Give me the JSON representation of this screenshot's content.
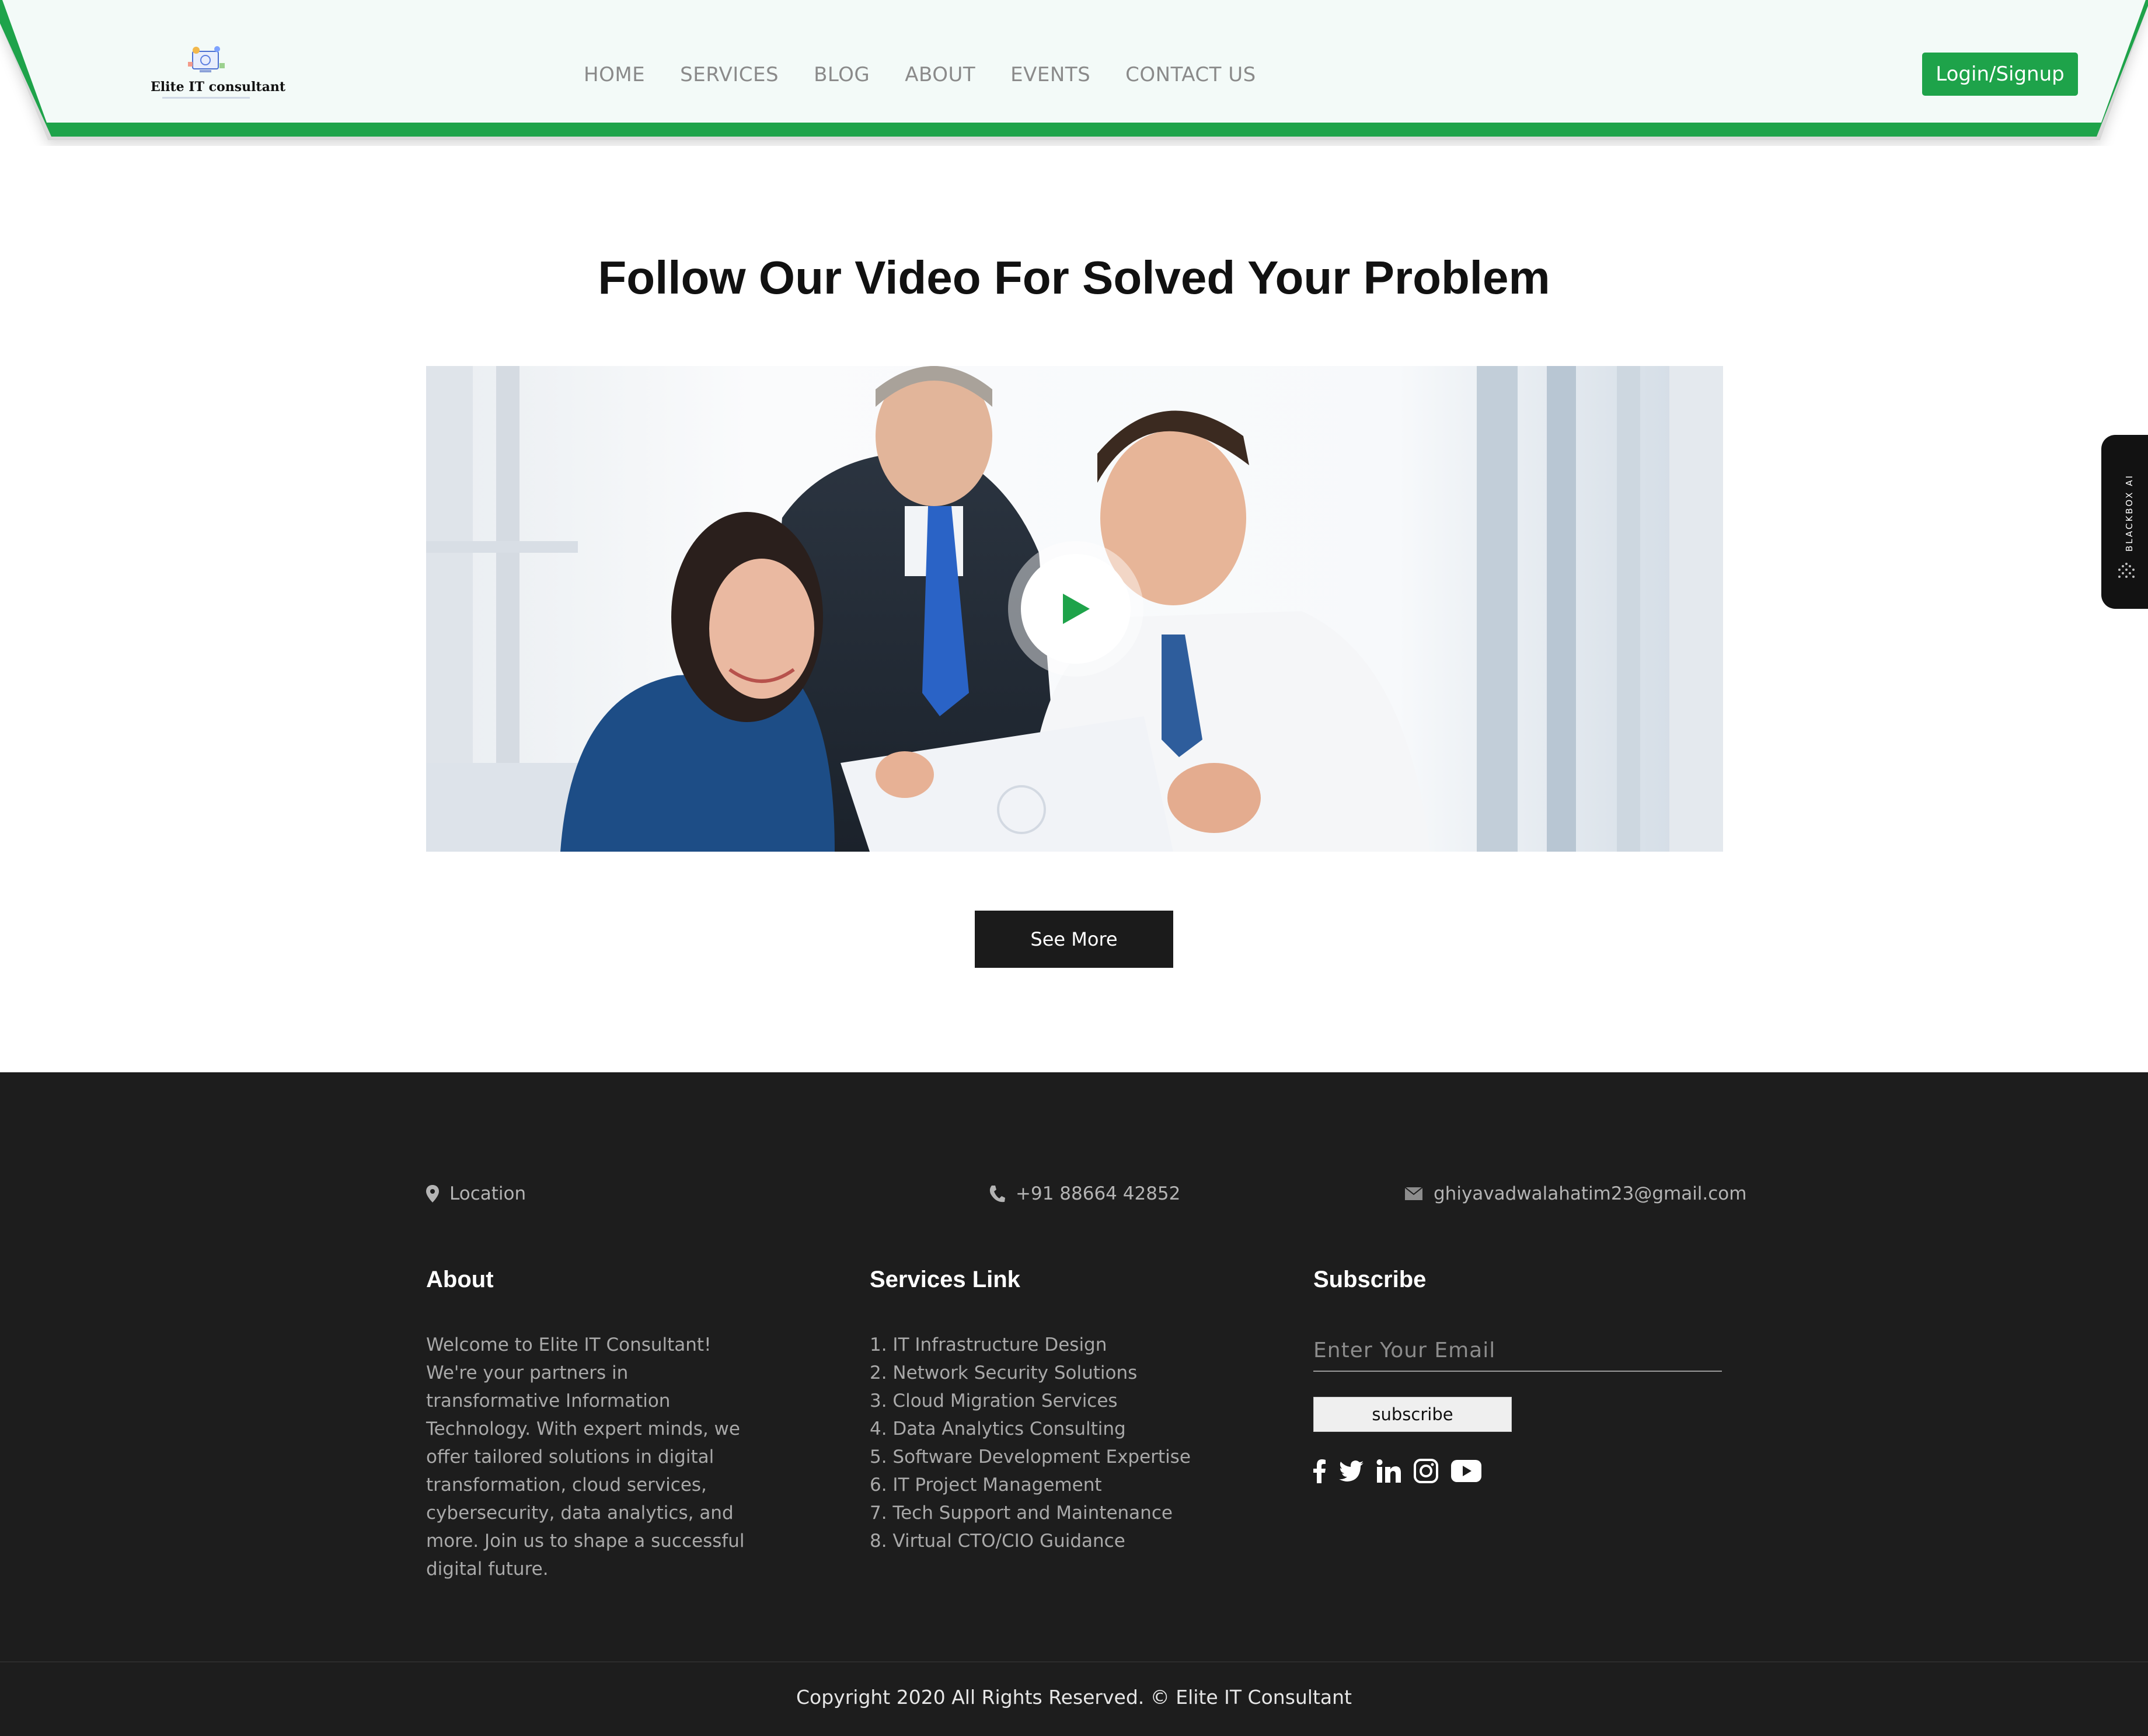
{
  "header": {
    "logo_text": "Elite IT consultant",
    "nav": [
      "HOME",
      "SERVICES",
      "BLOG",
      "ABOUT",
      "EVENTS",
      "CONTACT US"
    ],
    "login_label": "Login/Signup"
  },
  "side_widget": {
    "label": "BLACKBOX AI"
  },
  "main": {
    "title": "Follow Our Video For Solved Your Problem",
    "see_more_label": "See More"
  },
  "footer": {
    "location": "Location",
    "phone": "+91 88664 42852",
    "email": "ghiyavadwalahatim23@gmail.com",
    "about_title": "About",
    "about_text": "Welcome to Elite IT Consultant! We're your partners in transformative Information Technology. With expert minds, we offer tailored solutions in digital transformation, cloud services, cybersecurity, data analytics, and more. Join us to shape a successful digital future.",
    "services_title": "Services Link",
    "services": [
      "1. IT Infrastructure Design",
      "2. Network Security Solutions",
      "3. Cloud Migration Services",
      "4. Data Analytics Consulting",
      "5. Software Development Expertise",
      "6. IT Project Management",
      "7. Tech Support and Maintenance",
      "8. Virtual CTO/CIO Guidance"
    ],
    "subscribe_title": "Subscribe",
    "email_placeholder": "Enter Your Email",
    "subscribe_label": "subscribe",
    "socials": [
      "facebook-icon",
      "twitter-icon",
      "linkedin-icon",
      "instagram-icon",
      "youtube-icon"
    ],
    "copyright": "Copyright 2020 All Rights Reserved. © Elite IT Consultant"
  },
  "colors": {
    "accent_green": "#1ea34a",
    "footer_bg": "#1d1d1d",
    "header_bg": "#f3faf8"
  }
}
